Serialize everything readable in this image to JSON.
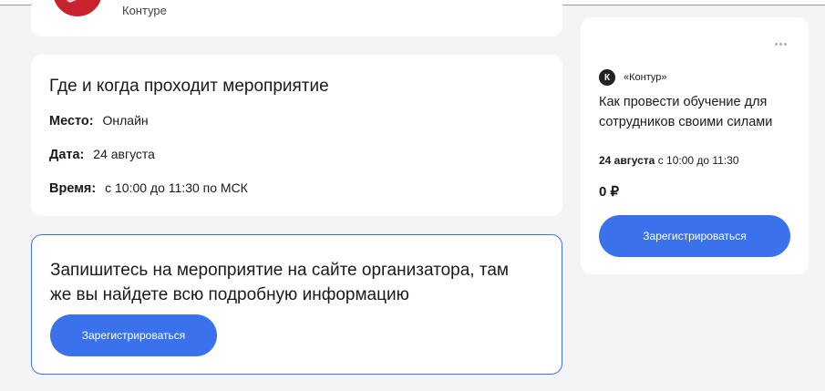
{
  "organizer": {
    "name": "Контуре"
  },
  "event_info": {
    "title": "Где и когда проходит мероприятие",
    "place_label": "Место:",
    "place_value": "Онлайн",
    "date_label": "Дата:",
    "date_value": "24 августа",
    "time_label": "Время:",
    "time_value": "с 10:00 до 11:30 по МСК"
  },
  "register_block": {
    "text": "Запишитесь на мероприятие на сайте организатора, там же вы найдете всю подробную информацию",
    "button_label": "Зарегистрироваться",
    "accent": "#3a72ec"
  },
  "side_card": {
    "brand_logo": "К",
    "brand_name": "«Контур»",
    "title": "Как провести обучение для сотрудников своими силами",
    "date_bold": "24 августа",
    "date_rest": "с 10:00 до 11:30",
    "price": "0 ₽",
    "button_label": "Зарегистрироваться",
    "more_icon": "more-dots-icon"
  }
}
